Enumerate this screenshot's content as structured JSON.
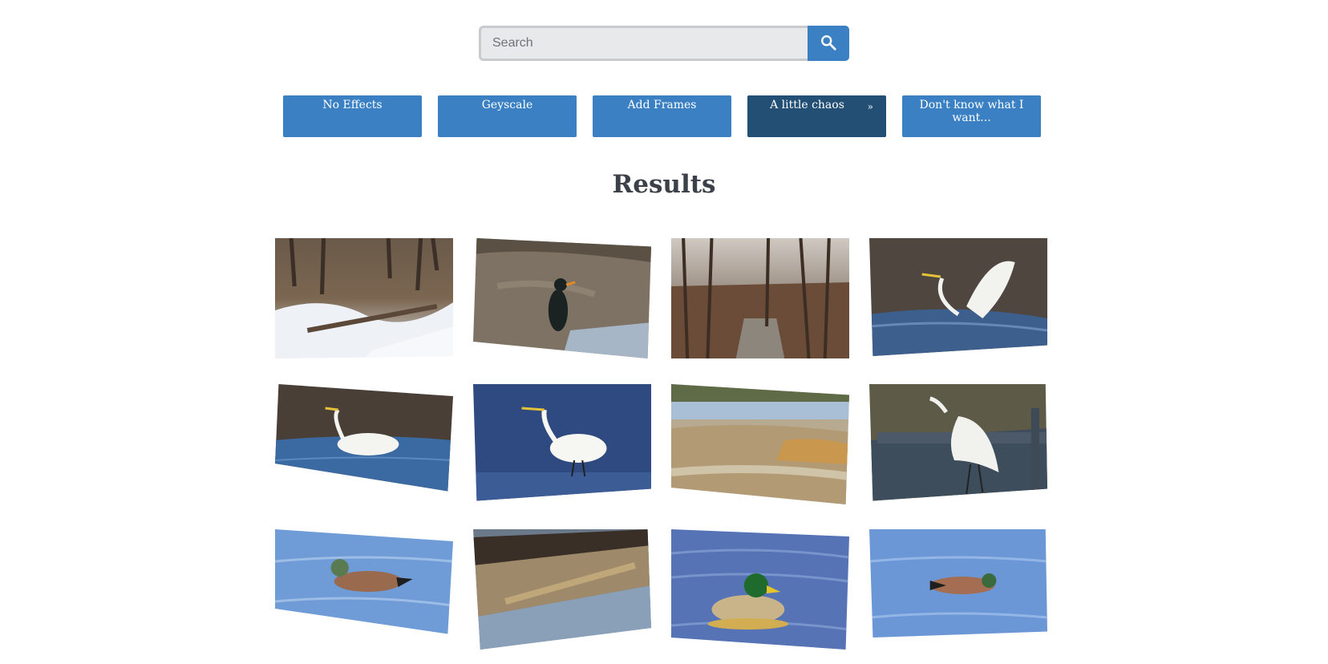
{
  "search": {
    "placeholder": "Search"
  },
  "icons": {
    "search_button": "search-icon"
  },
  "effects": [
    {
      "label": "No Effects"
    },
    {
      "label": "Geyscale"
    },
    {
      "label": "Add Frames"
    },
    {
      "label": "A little chaos",
      "suffix": "»",
      "active": true
    },
    {
      "label": "Don't know what I want..."
    }
  ],
  "results": {
    "title": "Results",
    "images": [
      {
        "subject": "snowy-woodland-creek"
      },
      {
        "subject": "cormorant-on-mudflat"
      },
      {
        "subject": "bare-winter-trees"
      },
      {
        "subject": "egret-spreading-wings"
      },
      {
        "subject": "egret-wading"
      },
      {
        "subject": "egret-in-deep-blue-water"
      },
      {
        "subject": "dry-grass-marsh"
      },
      {
        "subject": "egret-landing-by-fence"
      },
      {
        "subject": "wigeon-swimming"
      },
      {
        "subject": "marsh-bank-channel"
      },
      {
        "subject": "mallard-drake"
      },
      {
        "subject": "wigeon-feeding"
      }
    ]
  },
  "colors": {
    "accent": "#3a80c2",
    "accent_active": "#234f75",
    "title_text": "#3c4048"
  }
}
